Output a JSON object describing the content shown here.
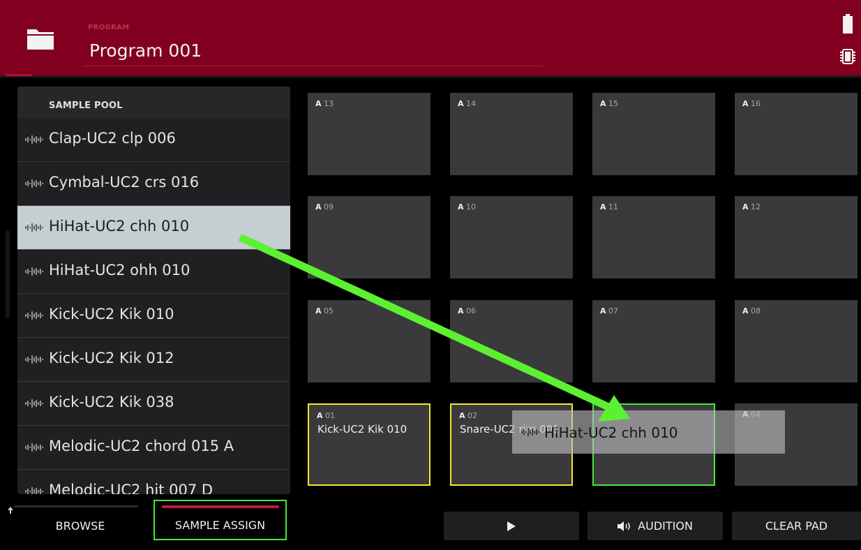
{
  "header": {
    "program_label": "PROGRAM",
    "program_name": "Program 001",
    "folder_icon": "folder-icon",
    "battery_icon": "battery-icon",
    "chip_icon": "chip-icon"
  },
  "sample_pool": {
    "title": "SAMPLE POOL",
    "items": [
      {
        "label": "Clap-UC2 clp 006"
      },
      {
        "label": "Cymbal-UC2 crs 016"
      },
      {
        "label": "HiHat-UC2 chh 010",
        "selected": true
      },
      {
        "label": "HiHat-UC2 ohh 010"
      },
      {
        "label": "Kick-UC2 Kik 010"
      },
      {
        "label": "Kick-UC2 Kik 012"
      },
      {
        "label": "Kick-UC2 Kik 038"
      },
      {
        "label": "Melodic-UC2 chord 015 A"
      },
      {
        "label": "Melodic-UC2 hit 007 D"
      }
    ]
  },
  "pads": {
    "bank": "A",
    "rows": [
      [
        {
          "num": "13"
        },
        {
          "num": "14"
        },
        {
          "num": "15"
        },
        {
          "num": "16"
        }
      ],
      [
        {
          "num": "09"
        },
        {
          "num": "10"
        },
        {
          "num": "11"
        },
        {
          "num": "12"
        }
      ],
      [
        {
          "num": "05"
        },
        {
          "num": "06"
        },
        {
          "num": "07"
        },
        {
          "num": "08"
        }
      ],
      [
        {
          "num": "01",
          "sample": "Kick-UC2 Kik 010",
          "state": "yellow"
        },
        {
          "num": "02",
          "sample": "Snare-UC2 rim 001",
          "state": "yellow"
        },
        {
          "num": "03",
          "state": "green"
        },
        {
          "num": "04"
        }
      ]
    ]
  },
  "drag_ghost": {
    "label": "HiHat-UC2 chh 010"
  },
  "bottom_bar": {
    "browse": "BROWSE",
    "sample_assign": "SAMPLE ASSIGN",
    "play_icon": "play-icon",
    "audition": "AUDITION",
    "clear_pad": "CLEAR PAD"
  },
  "colors": {
    "header_bg": "#82001f",
    "pad_bg": "#3a3a3c",
    "pad_assigned": "#f0e830",
    "pad_target": "#48e83a",
    "arrow": "#5cf032"
  }
}
